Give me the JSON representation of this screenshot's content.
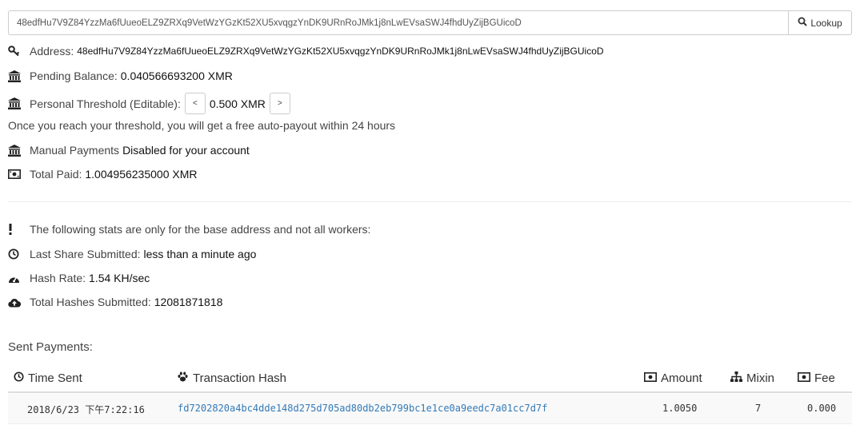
{
  "search": {
    "value": "48edfHu7V9Z84YzzMa6fUueoELZ9ZRXq9VetWzYGzKt52XU5xvqgzYnDK9URnRoJMk1j8nLwEVsaSWJ4fhdUyZijBGUicoD",
    "button_label": "Lookup"
  },
  "account": {
    "address_label": "Address:",
    "address_value": "48edfHu7V9Z84YzzMa6fUueoELZ9ZRXq9VetWzYGzKt52XU5xvqgzYnDK9URnRoJMk1j8nLwEVsaSWJ4fhdUyZijBGUicoD",
    "pending_label": "Pending Balance:",
    "pending_value": "0.040566693200 XMR",
    "threshold_label": "Personal Threshold (Editable):",
    "threshold_dec": "<",
    "threshold_value": "0.500 XMR",
    "threshold_inc": ">",
    "threshold_note": "Once you reach your threshold, you will get a free auto-payout within 24 hours",
    "manual_label": "Manual Payments",
    "manual_value": "Disabled for your account",
    "total_paid_label": "Total Paid:",
    "total_paid_value": "1.004956235000 XMR"
  },
  "stats": {
    "notice": "The following stats are only for the base address and not all workers:",
    "last_share_label": "Last Share Submitted:",
    "last_share_value": "less than a minute ago",
    "hash_rate_label": "Hash Rate:",
    "hash_rate_value": "1.54 KH/sec",
    "total_hashes_label": "Total Hashes Submitted:",
    "total_hashes_value": "12081871818"
  },
  "payments": {
    "title": "Sent Payments:",
    "columns": {
      "time": "Time Sent",
      "hash": "Transaction Hash",
      "amount": "Amount",
      "mixin": "Mixin",
      "fee": "Fee"
    },
    "rows": [
      {
        "time": "2018/6/23 下午7:22:16",
        "hash": "fd7202820a4bc4dde148d275d705ad80db2eb799bc1e1ce0a9eedc7a01cc7d7f",
        "amount": "1.0050",
        "mixin": "7",
        "fee": "0.000"
      }
    ]
  }
}
